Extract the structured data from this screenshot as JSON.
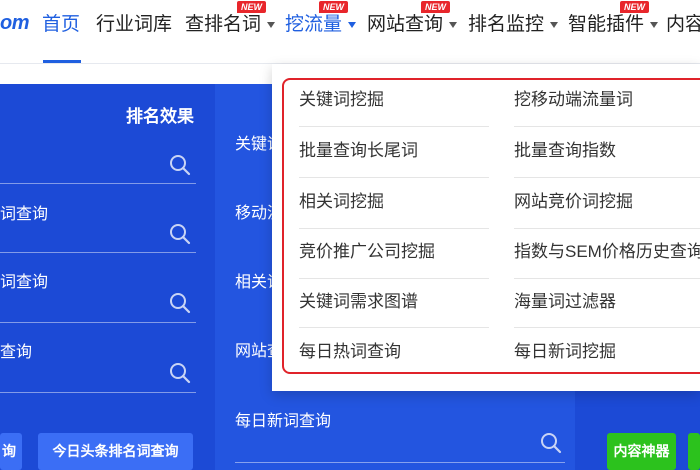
{
  "header": {
    "logo_text": "om",
    "nav": [
      {
        "label": "首页",
        "active": true,
        "dropdown": false,
        "badge": ""
      },
      {
        "label": "行业词库",
        "active": false,
        "dropdown": false,
        "badge": ""
      },
      {
        "label": "查排名词",
        "active": false,
        "dropdown": true,
        "badge": "NEW"
      },
      {
        "label": "挖流量",
        "active": true,
        "dropdown": true,
        "badge": "NEW"
      },
      {
        "label": "网站查询",
        "active": false,
        "dropdown": true,
        "badge": "NEW"
      },
      {
        "label": "排名监控",
        "active": false,
        "dropdown": true,
        "badge": ""
      },
      {
        "label": "智能插件",
        "active": false,
        "dropdown": true,
        "badge": "NEW"
      },
      {
        "label": "内容",
        "active": false,
        "dropdown": false,
        "badge": ""
      }
    ]
  },
  "left_panel": {
    "title": "排名效果",
    "fields": [
      "词查询",
      "词查询",
      "查询"
    ],
    "button": "询"
  },
  "middle_panel": {
    "fields": [
      "关键词",
      "移动流",
      "相关词",
      "网站查",
      "每日新词查询"
    ],
    "button": "今日头条排名词查询"
  },
  "right_panel": {
    "button": "内容神器"
  },
  "dropdown": {
    "items_left": [
      "关键词挖掘",
      "批量查询长尾词",
      "相关词挖掘",
      "竞价推广公司挖掘",
      "关键词需求图谱",
      "每日热词查询"
    ],
    "items_right": [
      "挖移动端流量词",
      "批量查询指数",
      "网站竞价词挖掘",
      "指数与SEM价格历史查询",
      "海量词过滤器",
      "每日新词挖掘"
    ]
  },
  "colors": {
    "accent": "#1f5fe0",
    "panel_blue": "#1c4ad6",
    "badge_red": "#e8262b",
    "highlight_red": "#e0232a",
    "button_green": "#2cc21d"
  },
  "icons": {
    "search": "magnifier-icon",
    "caret": "caret-down-icon"
  }
}
